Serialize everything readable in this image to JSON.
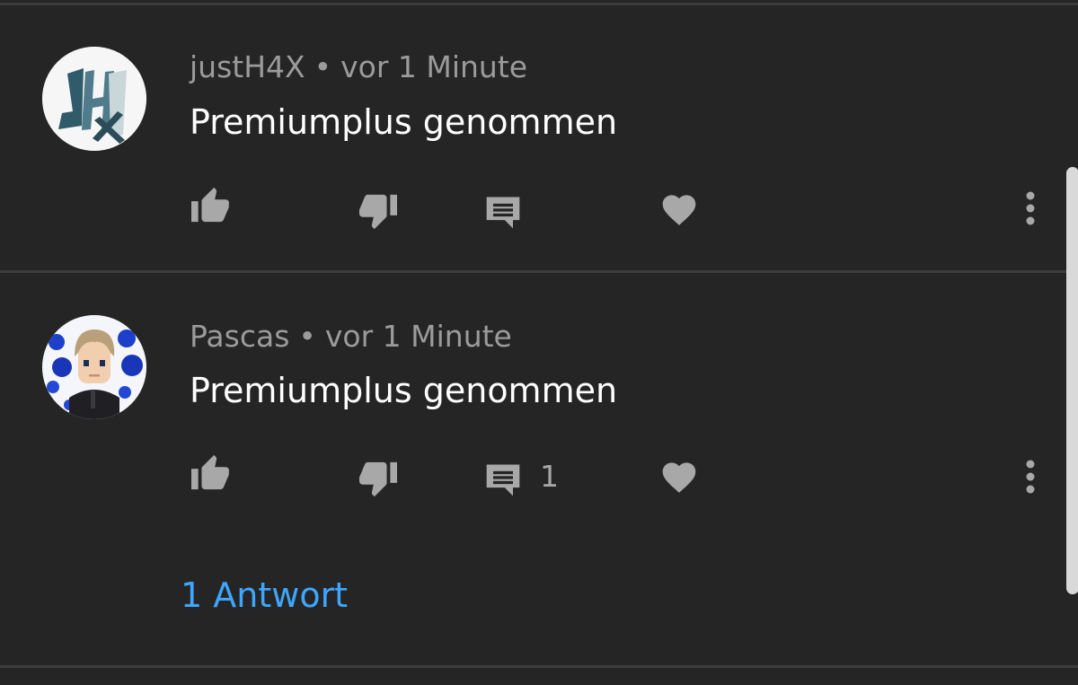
{
  "comments": [
    {
      "author": "justH4X",
      "separator": "•",
      "time": "vor 1 Minute",
      "text": "Premiumplus genommen",
      "avatar_icon": "jh4x-logo-avatar",
      "reply_count": ""
    },
    {
      "author": "Pascas",
      "separator": "•",
      "time": "vor 1 Minute",
      "text": "Premiumplus genommen",
      "avatar_icon": "cartoon-boy-avatar",
      "reply_count": "1",
      "replies_link": "1 Antwort"
    }
  ],
  "icons": {
    "like": "thumb-up-icon",
    "dislike": "thumb-down-icon",
    "reply": "comment-icon",
    "heart": "heart-icon",
    "more": "more-vertical-icon"
  },
  "colors": {
    "background": "#252525",
    "meta_text": "#9b9b9b",
    "comment_text": "#ffffff",
    "icon": "#a8a8a8",
    "link": "#3ea6ff"
  }
}
